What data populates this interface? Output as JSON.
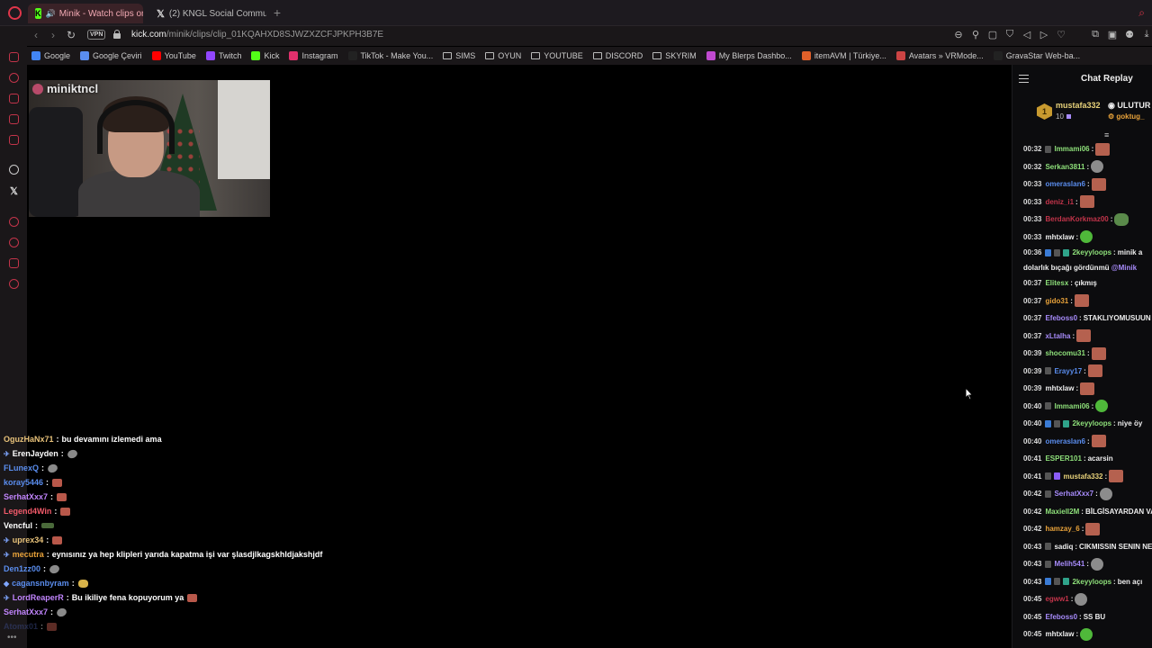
{
  "tabs": [
    {
      "label": "Minik - Watch clips on",
      "active": true
    },
    {
      "label": "(2) KNGL Social Communi",
      "active": false
    }
  ],
  "address": {
    "vpn": "VPN",
    "url_host": "kick.com",
    "url_path": "/minik/clips/clip_01KQAHXD8SJWZXZCFJPKPH3B7E"
  },
  "bookmarks": [
    {
      "label": "Google",
      "color": "#4285f4"
    },
    {
      "label": "Google Çeviri",
      "color": "#5a8dee"
    },
    {
      "label": "YouTube",
      "color": "#ff0000"
    },
    {
      "label": "Twitch",
      "color": "#9146ff"
    },
    {
      "label": "Kick",
      "color": "#53fc18"
    },
    {
      "label": "Instagram",
      "color": "#e1306c"
    },
    {
      "label": "TikTok - Make You...",
      "color": "#222222"
    },
    {
      "label": "SIMS",
      "color": "folder"
    },
    {
      "label": "OYUN",
      "color": "folder"
    },
    {
      "label": "YOUTUBE",
      "color": "folder"
    },
    {
      "label": "DISCORD",
      "color": "folder"
    },
    {
      "label": "SKYRIM",
      "color": "folder"
    },
    {
      "label": "My Blerps Dashbo...",
      "color": "#c04ad0"
    },
    {
      "label": "itemAVM | Türkiye...",
      "color": "#e0602a"
    },
    {
      "label": "Avatars » VRMode...",
      "color": "#cc4444"
    },
    {
      "label": "GravaStar Web-ba...",
      "color": "#222222"
    }
  ],
  "webcam": {
    "streamer_name": "miniktncl"
  },
  "overlay_chat": [
    {
      "user": "OguzHaNx71",
      "color": "#e8c27a",
      "badge": "",
      "msg": "bu devamını izlemedi ama",
      "emote": ""
    },
    {
      "user": "ErenJayden",
      "color": "#ffffff",
      "badge": "✈",
      "msg": "",
      "emote": "gray"
    },
    {
      "user": "FLunexQ",
      "color": "#5a8dee",
      "badge": "",
      "msg": "",
      "emote": "gray"
    },
    {
      "user": "koray5446",
      "color": "#5a8dee",
      "badge": "",
      "msg": "",
      "emote": "face"
    },
    {
      "user": "SerhatXxx7",
      "color": "#c084fc",
      "badge": "",
      "msg": "",
      "emote": "face"
    },
    {
      "user": "Legend4Win",
      "color": "#f25a6a",
      "badge": "",
      "msg": "",
      "emote": "face"
    },
    {
      "user": "Vencful",
      "color": "#ffffff",
      "badge": "",
      "msg": "",
      "emote": "car"
    },
    {
      "user": "uprex34",
      "color": "#e8c27a",
      "badge": "✈",
      "msg": "",
      "emote": "face"
    },
    {
      "user": "mecutra",
      "color": "#e8a23a",
      "badge": "✈",
      "msg": "eynısınız ya hep klipleri yarıda kapatma işi var şlasdjlkagskhldjakshjdf",
      "emote": ""
    },
    {
      "user": "Den1zz00",
      "color": "#5a8dee",
      "badge": "",
      "msg": "",
      "emote": "gray"
    },
    {
      "user": "cagansnbyram",
      "color": "#5a8dee",
      "badge": "◆",
      "msg": "",
      "emote": "hand"
    },
    {
      "user": "LordReaperR",
      "color": "#c084fc",
      "badge": "✈",
      "msg": "Bu ikiliye fena kopuyorum ya",
      "emote": "face"
    },
    {
      "user": "SerhatXxx7",
      "color": "#c084fc",
      "badge": "",
      "msg": "",
      "emote": "gray"
    },
    {
      "user": "Atomx01",
      "color": "#3a4a8a",
      "badge": "",
      "msg": "",
      "emote": "face"
    }
  ],
  "chat": {
    "title": "Chat Replay",
    "pinned": {
      "rank": "1",
      "user": "mustafa332",
      "count": "10",
      "user2": "ULUTUR",
      "user3": "goktug_"
    },
    "lines": [
      {
        "ts": "00:32",
        "badges": [
          "gray"
        ],
        "user": "Immami06",
        "color": "#8ee07a",
        "msg": "",
        "emote": "face"
      },
      {
        "ts": "00:32",
        "badges": [],
        "user": "Serkan3811",
        "color": "#8ee07a",
        "msg": "",
        "emote": "gray"
      },
      {
        "ts": "00:33",
        "badges": [],
        "user": "omeraslan6",
        "color": "#5a8dee",
        "msg": "",
        "emote": "face"
      },
      {
        "ts": "00:33",
        "badges": [],
        "user": "deniz_i1",
        "color": "#c2344a",
        "msg": "",
        "emote": "face"
      },
      {
        "ts": "00:33",
        "badges": [],
        "user": "BerdanKorkmaz00",
        "color": "#c2344a",
        "msg": "",
        "emote": "frog"
      },
      {
        "ts": "00:33",
        "badges": [],
        "user": "mhtxlaw",
        "color": "#eeeeee",
        "msg": "",
        "emote": "green"
      },
      {
        "ts": "00:36",
        "badges": [
          "blue",
          "gray",
          "teal"
        ],
        "user": "2keyyloops",
        "color": "#8ee07a",
        "msg": "minik a",
        "emote": "",
        "wrap": "dolarlık bıçağı gördünmü ",
        "mention": "@Minik"
      },
      {
        "ts": "00:37",
        "badges": [],
        "user": "Elitesx",
        "color": "#8ee07a",
        "msg": "çıkmış",
        "emote": ""
      },
      {
        "ts": "00:37",
        "badges": [],
        "user": "gido31",
        "color": "#e8a23a",
        "msg": "",
        "emote": "face"
      },
      {
        "ts": "00:37",
        "badges": [],
        "user": "Efeboss0",
        "color": "#a78bfa",
        "msg": "STAKLIYOMUSUUN",
        "emote": ""
      },
      {
        "ts": "00:37",
        "badges": [],
        "user": "xLtalha",
        "color": "#a78bfa",
        "msg": "",
        "emote": "face"
      },
      {
        "ts": "00:39",
        "badges": [],
        "user": "shocomu31",
        "color": "#8ee07a",
        "msg": "",
        "emote": "face"
      },
      {
        "ts": "00:39",
        "badges": [
          "gray"
        ],
        "user": "Erayy17",
        "color": "#5a8dee",
        "msg": "",
        "emote": "face"
      },
      {
        "ts": "00:39",
        "badges": [],
        "user": "mhtxlaw",
        "color": "#eeeeee",
        "msg": "",
        "emote": "face"
      },
      {
        "ts": "00:40",
        "badges": [
          "gray"
        ],
        "user": "Immami06",
        "color": "#8ee07a",
        "msg": "",
        "emote": "green"
      },
      {
        "ts": "00:40",
        "badges": [
          "blue",
          "gray",
          "teal"
        ],
        "user": "2keyyloops",
        "color": "#8ee07a",
        "msg": "niye öy",
        "emote": ""
      },
      {
        "ts": "00:40",
        "badges": [],
        "user": "omeraslan6",
        "color": "#5a8dee",
        "msg": "",
        "emote": "face"
      },
      {
        "ts": "00:41",
        "badges": [],
        "user": "ESPER101",
        "color": "#8ee07a",
        "msg": "acarsin",
        "emote": ""
      },
      {
        "ts": "00:41",
        "badges": [
          "gray",
          "purple"
        ],
        "user": "mustafa332",
        "color": "#e8d27a",
        "msg": "",
        "emote": "face"
      },
      {
        "ts": "00:42",
        "badges": [
          "gray"
        ],
        "user": "SerhatXxx7",
        "color": "#a78bfa",
        "msg": "",
        "emote": "gray"
      },
      {
        "ts": "00:42",
        "badges": [],
        "user": "Maxiell2M",
        "color": "#8ee07a",
        "msg": "BİLGİSAYARDAN VA",
        "emote": ""
      },
      {
        "ts": "00:42",
        "badges": [],
        "user": "hamzay_6",
        "color": "#e8a23a",
        "msg": "",
        "emote": "face"
      },
      {
        "ts": "00:43",
        "badges": [
          "gray"
        ],
        "user": "sadiq",
        "color": "#eeeeee",
        "msg": "CIKMISSIN SENIN NE",
        "emote": ""
      },
      {
        "ts": "00:43",
        "badges": [
          "gray"
        ],
        "user": "Melih541",
        "color": "#a78bfa",
        "msg": "",
        "emote": "gray"
      },
      {
        "ts": "00:43",
        "badges": [
          "blue",
          "gray",
          "teal"
        ],
        "user": "2keyyloops",
        "color": "#8ee07a",
        "msg": "ben açı",
        "emote": ""
      },
      {
        "ts": "00:45",
        "badges": [],
        "user": "egww1",
        "color": "#c2344a",
        "msg": "",
        "emote": "gray"
      },
      {
        "ts": "00:45",
        "badges": [],
        "user": "Efeboss0",
        "color": "#a78bfa",
        "msg": "SS BU",
        "emote": ""
      },
      {
        "ts": "00:45",
        "badges": [],
        "user": "mhtxlaw",
        "color": "#eeeeee",
        "msg": "",
        "emote": "green"
      }
    ]
  },
  "colors": {
    "accent": "#e0364a",
    "kick_green": "#53fc18"
  }
}
